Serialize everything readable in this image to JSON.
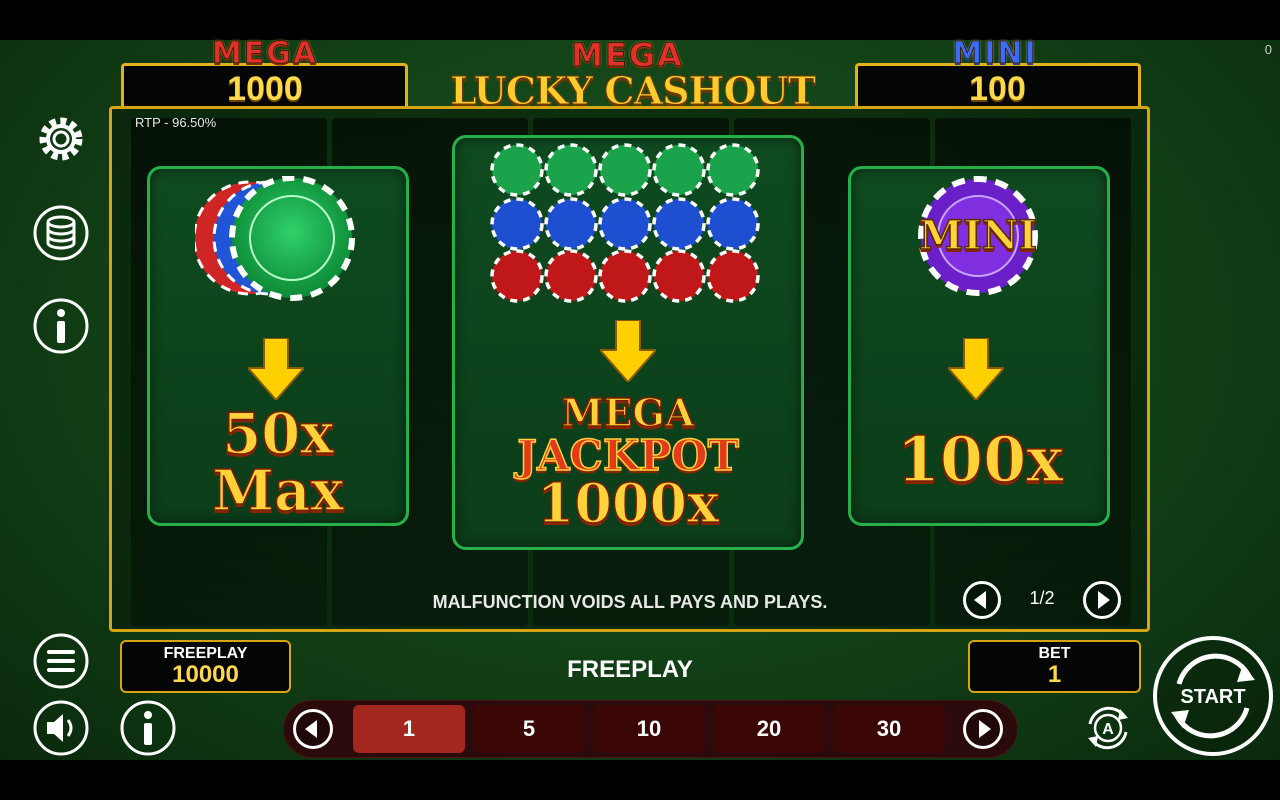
{
  "corner_indicator": "0",
  "jackpots": {
    "left": {
      "label": "MEGA",
      "value": "1000"
    },
    "title": {
      "line1": "MEGA",
      "line2": "LUCKY CASHOUT"
    },
    "right": {
      "label": "MINI",
      "value": "100"
    }
  },
  "rtp_text": "RTP - 96.50%",
  "paytable": {
    "left": {
      "line1": "50x",
      "line2": "Max"
    },
    "center": {
      "line1": "MEGA",
      "line2": "JACKPOT",
      "line3": "1000x"
    },
    "right": {
      "chip_text": "MINI",
      "line1": "100x"
    }
  },
  "malfunction_text": "MALFUNCTION VOIDS ALL PAYS AND PLAYS.",
  "page_indicator": "1/2",
  "freeplay_box": {
    "label": "FREEPLAY",
    "value": "10000"
  },
  "center_status": "FREEPLAY",
  "bet_box": {
    "label": "BET",
    "value": "1"
  },
  "bet_options": [
    "1",
    "5",
    "10",
    "20",
    "30"
  ],
  "selected_bet": "1",
  "start_label": "START",
  "icons": [
    "gear-icon",
    "coin-stack-icon",
    "info-icon",
    "menu-icon",
    "speaker-icon",
    "info-icon",
    "autoplay-icon",
    "start-icon",
    "chevron-left-icon",
    "chevron-right-icon",
    "arrow-down-icon"
  ],
  "colors": {
    "felt": "#124016",
    "gold": "#d6a515",
    "panel_border": "#27b04a",
    "active_bet": "#a3271f",
    "jackpot_text": "#ffd94a"
  }
}
